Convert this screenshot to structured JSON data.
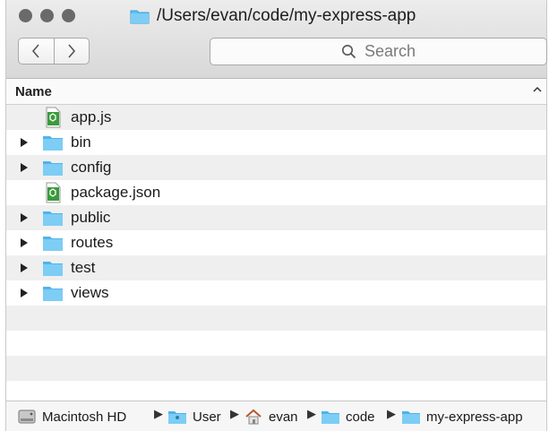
{
  "window": {
    "title": "/Users/evan/code/my-express-app",
    "title_icon": "folder-icon"
  },
  "toolbar": {
    "back_icon": "chevron-left-icon",
    "forward_icon": "chevron-right-icon",
    "search": {
      "placeholder": "Search",
      "icon": "magnifier-icon"
    }
  },
  "columns": {
    "name_header": "Name",
    "sort_indicator": "^"
  },
  "files": [
    {
      "name": "app.js",
      "kind": "js-file",
      "expandable": false
    },
    {
      "name": "bin",
      "kind": "folder",
      "expandable": true
    },
    {
      "name": "config",
      "kind": "folder",
      "expandable": true
    },
    {
      "name": "package.json",
      "kind": "js-file",
      "expandable": false
    },
    {
      "name": "public",
      "kind": "folder",
      "expandable": true
    },
    {
      "name": "routes",
      "kind": "folder",
      "expandable": true
    },
    {
      "name": "test",
      "kind": "folder",
      "expandable": true
    },
    {
      "name": "views",
      "kind": "folder",
      "expandable": true
    }
  ],
  "pathbar": [
    {
      "label": "Macintosh HD",
      "icon": "hard-drive-icon"
    },
    {
      "label": "User",
      "icon": "users-folder-icon"
    },
    {
      "label": "evan",
      "icon": "home-icon"
    },
    {
      "label": "code",
      "icon": "folder-icon"
    },
    {
      "label": "my-express-app",
      "icon": "folder-icon"
    }
  ],
  "colors": {
    "folder_blue": "#5ec0f2",
    "js_file_green": "#3b9a3b",
    "row_stripe": "#efefef"
  }
}
